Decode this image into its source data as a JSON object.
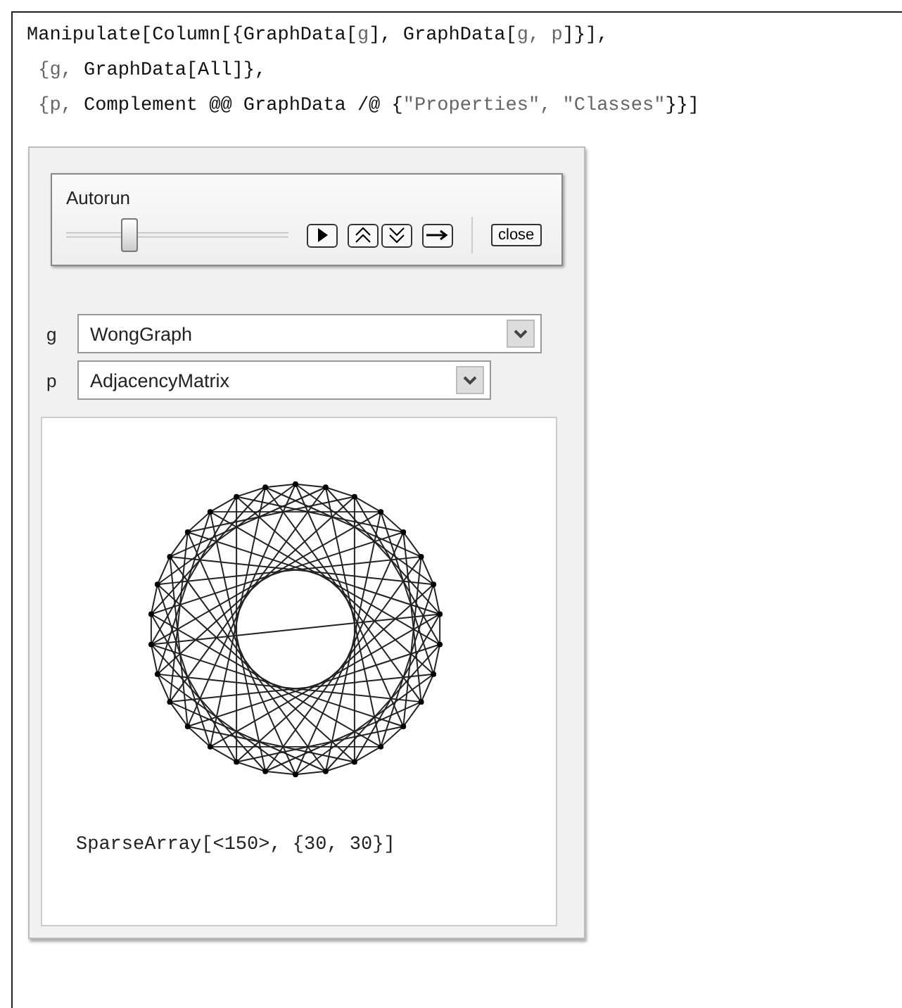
{
  "input_cell": {
    "lines": [
      "**Manipulate[Column[{GraphData[**g**], GraphData[**g, p**]}],**",
      " {g, **GraphData[All]},**",
      " {p, **Complement @@ GraphData /@ {**\"Properties\", \"Classes\"**}}]**"
    ]
  },
  "autorun": {
    "label": "Autorun",
    "slider": {
      "level": 0.28
    },
    "close_button": "close"
  },
  "controls": [
    {
      "label": "g",
      "value": "WongGraph"
    },
    {
      "label": "p",
      "value": "AdjacencyMatrix"
    }
  ],
  "output": {
    "result": "SparseArray[<150>, {30, 30}]"
  }
}
